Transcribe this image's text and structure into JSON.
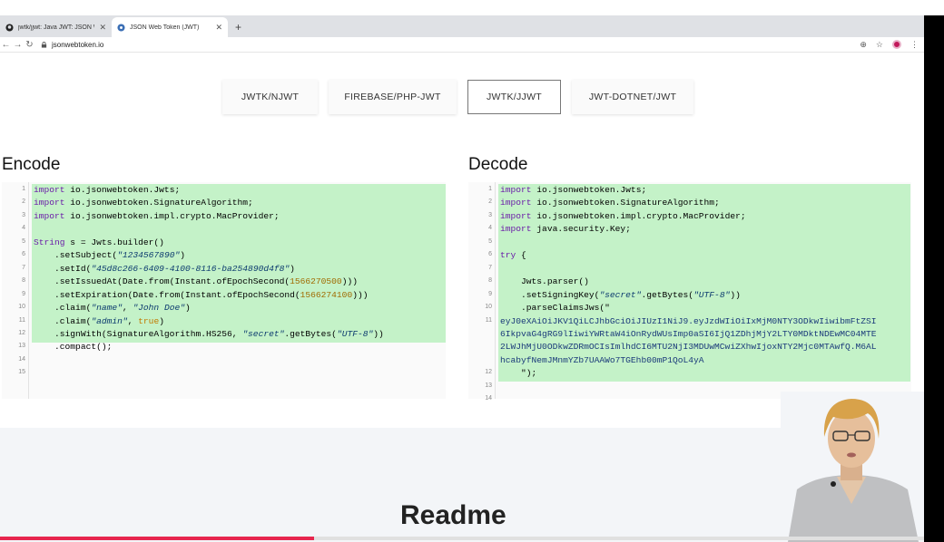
{
  "browser": {
    "tabs": [
      {
        "title": "jwtk/jjwt: Java JWT: JSON Web",
        "active": false
      },
      {
        "title": "JSON Web Token (JWT)",
        "active": true
      }
    ],
    "url": "jsonwebtoken.io"
  },
  "library_tabs": [
    {
      "label": "JWTK/NJWT"
    },
    {
      "label": "FIREBASE/PHP-JWT"
    },
    {
      "label": "JWTK/JJWT",
      "selected": true
    },
    {
      "label": "JWT-DOTNET/JWT"
    }
  ],
  "encode": {
    "title": "Encode",
    "line_numbers": [
      "1",
      "2",
      "3",
      "4",
      "5",
      "6",
      "7",
      "8",
      "9",
      "10",
      "11",
      "12",
      "13",
      "14",
      "15"
    ],
    "lines": [
      "import io.jsonwebtoken.Jwts;",
      "import io.jsonwebtoken.SignatureAlgorithm;",
      "import io.jsonwebtoken.impl.crypto.MacProvider;",
      "",
      "String s = Jwts.builder()",
      "    .setSubject(\"1234567890\")",
      "    .setId(\"45d8c266-6409-4100-8116-ba254890d4f8\")",
      "    .setIssuedAt(Date.from(Instant.ofEpochSecond(1566270500)))",
      "    .setExpiration(Date.from(Instant.ofEpochSecond(1566274100)))",
      "    .claim(\"name\", \"John Doe\")",
      "    .claim(\"admin\", true)",
      "    .signWith(SignatureAlgorithm.HS256, \"secret\".getBytes(\"UTF-8\"))",
      "    .compact();",
      "",
      ""
    ]
  },
  "decode": {
    "title": "Decode",
    "line_numbers": [
      "1",
      "2",
      "3",
      "4",
      "5",
      "6",
      "7",
      "8",
      "9",
      "10",
      "11",
      "",
      "",
      "",
      "12",
      "13",
      "14"
    ],
    "lines": [
      "import io.jsonwebtoken.Jwts;",
      "import io.jsonwebtoken.SignatureAlgorithm;",
      "import io.jsonwebtoken.impl.crypto.MacProvider;",
      "import java.security.Key;",
      "",
      "try {",
      "",
      "    Jwts.parser()",
      "    .setSigningKey(\"secret\".getBytes(\"UTF-8\"))",
      "    .parseClaimsJws(\"",
      "eyJ0eXAiOiJKV1QiLCJhbGciOiJIUzI1NiJ9.eyJzdWIiOiIxMjM0NTY3ODkwIiwibmFtZSI",
      "6IkpvaG4gRG9lIiwiYWRtaW4iOnRydWUsImp0aSI6IjQ1ZDhjMjY2LTY0MDktNDEwMC04MTE",
      "2LWJhMjU0ODkwZDRmOCIsImlhdCI6MTU2NjI3MDUwMCwiZXhwIjoxNTY2Mjc0MTAwfQ.M6AL",
      "hcabyfNemJMnmYZb7UAAWo7TGEhb00mP1QoL4yA",
      "    \");",
      "",
      ""
    ]
  },
  "readme_heading": "Readme",
  "video_progress": 0.34,
  "colors": {
    "code_highlight": "#c4f2c8",
    "progress": "#e7264e",
    "keyword": "#6a1ba8"
  }
}
